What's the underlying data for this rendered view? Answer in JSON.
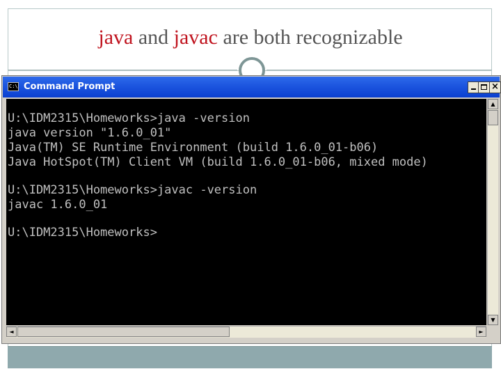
{
  "slide": {
    "title_parts": [
      {
        "text": "java",
        "accent": true
      },
      {
        "text": " and ",
        "accent": false
      },
      {
        "text": "javac",
        "accent": true
      },
      {
        "text": " are both recognizable",
        "accent": false
      }
    ]
  },
  "window": {
    "title": "Command Prompt",
    "icon_label": "C:\\",
    "buttons": {
      "minimize": "minimize",
      "maximize": "maximize",
      "close": "×"
    }
  },
  "console": {
    "lines": [
      "U:\\IDM2315\\Homeworks>java -version",
      "java version \"1.6.0_01\"",
      "Java(TM) SE Runtime Environment (build 1.6.0_01-b06)",
      "Java HotSpot(TM) Client VM (build 1.6.0_01-b06, mixed mode)",
      "",
      "U:\\IDM2315\\Homeworks>javac -version",
      "javac 1.6.0_01",
      "",
      "U:\\IDM2315\\Homeworks>"
    ]
  },
  "scrollbars": {
    "up_arrow": "▲",
    "down_arrow": "▼",
    "left_arrow": "◄",
    "right_arrow": "►"
  },
  "colors": {
    "accent": "#c0141f",
    "titlebar": "#1e57e0",
    "console_bg": "#000000",
    "console_fg": "#c0c0c0"
  }
}
